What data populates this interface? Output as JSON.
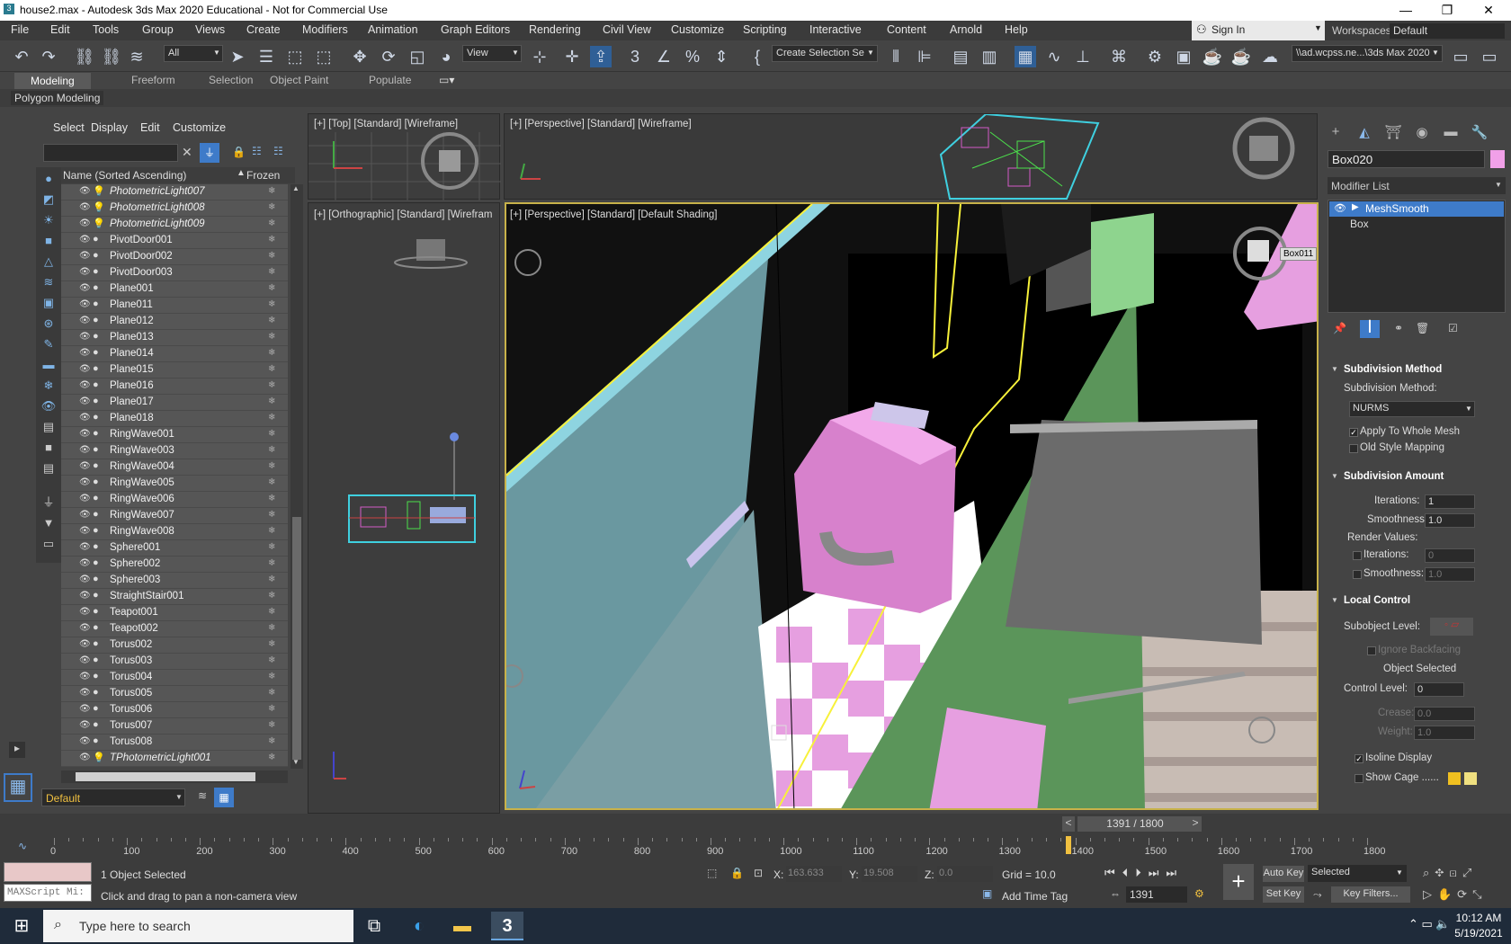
{
  "window": {
    "title": "house2.max - Autodesk 3ds Max 2020 Educational - Not for Commercial Use",
    "minimize": "—",
    "restore": "❐",
    "close": "✕"
  },
  "menu": [
    "File",
    "Edit",
    "Tools",
    "Group",
    "Views",
    "Create",
    "Modifiers",
    "Animation",
    "Graph Editors",
    "Rendering",
    "Civil View",
    "Customize",
    "Scripting",
    "Interactive",
    "Content",
    "Arnold",
    "Help"
  ],
  "signin": {
    "label": "Sign In"
  },
  "workspace": {
    "label": "Workspaces:",
    "value": "Default"
  },
  "toolbar": {
    "filter": "All",
    "refcoord": "View",
    "selection_set": "Create Selection Se",
    "path": "\\\\ad.wcpss.ne...\\3ds Max 2020"
  },
  "ribbon": {
    "tabs": [
      "Modeling",
      "Freeform",
      "Selection",
      "Object Paint",
      "Populate"
    ],
    "active": "Modeling",
    "panel": "Polygon Modeling"
  },
  "explorer": {
    "menu": [
      "Select",
      "Display",
      "Edit",
      "Customize"
    ],
    "col_name": "Name (Sorted Ascending)",
    "col_frozen": "Frozen",
    "rows": [
      {
        "name": "PhotometricLight007",
        "light": true
      },
      {
        "name": "PhotometricLight008",
        "light": true
      },
      {
        "name": "PhotometricLight009",
        "light": true
      },
      {
        "name": "PivotDoor001"
      },
      {
        "name": "PivotDoor002"
      },
      {
        "name": "PivotDoor003"
      },
      {
        "name": "Plane001"
      },
      {
        "name": "Plane011"
      },
      {
        "name": "Plane012"
      },
      {
        "name": "Plane013"
      },
      {
        "name": "Plane014"
      },
      {
        "name": "Plane015"
      },
      {
        "name": "Plane016"
      },
      {
        "name": "Plane017"
      },
      {
        "name": "Plane018"
      },
      {
        "name": "RingWave001"
      },
      {
        "name": "RingWave003"
      },
      {
        "name": "RingWave004"
      },
      {
        "name": "RingWave005"
      },
      {
        "name": "RingWave006"
      },
      {
        "name": "RingWave007"
      },
      {
        "name": "RingWave008"
      },
      {
        "name": "Sphere001"
      },
      {
        "name": "Sphere002"
      },
      {
        "name": "Sphere003"
      },
      {
        "name": "StraightStair001"
      },
      {
        "name": "Teapot001"
      },
      {
        "name": "Teapot002"
      },
      {
        "name": "Torus002"
      },
      {
        "name": "Torus003"
      },
      {
        "name": "Torus004"
      },
      {
        "name": "Torus005"
      },
      {
        "name": "Torus006"
      },
      {
        "name": "Torus007"
      },
      {
        "name": "Torus008"
      },
      {
        "name": "TPhotometricLight001",
        "light": true
      }
    ],
    "layer": "Default"
  },
  "viewports": {
    "top": "[+] [Top] [Standard] [Wireframe]",
    "persp_top": "[+] [Perspective] [Standard] [Wireframe]",
    "ortho": "[+] [Orthographic] [Standard] [Wirefram",
    "main": "[+] [Perspective] [Standard] [Default Shading]",
    "tooltip": "Box011"
  },
  "command_panel": {
    "object_name": "Box020",
    "modifier_list": "Modifier List",
    "stack": [
      "MeshSmooth",
      "Box"
    ],
    "subdiv_method": {
      "title": "Subdivision Method",
      "label": "Subdivision Method:",
      "value": "NURMS",
      "apply_whole": "Apply To Whole Mesh",
      "old_style": "Old Style Mapping"
    },
    "subdiv_amount": {
      "title": "Subdivision Amount",
      "iterations_label": "Iterations:",
      "iterations": "1",
      "smoothness_label": "Smoothness:",
      "smoothness": "1.0",
      "render_values": "Render Values:",
      "r_iterations": "0",
      "r_smoothness": "1.0"
    },
    "local_control": {
      "title": "Local Control",
      "subobject": "Subobject Level:",
      "ignore_backfacing": "Ignore Backfacing",
      "object_selected": "Object Selected",
      "control_level_label": "Control Level:",
      "control_level": "0",
      "crease_label": "Crease:",
      "crease": "0.0",
      "weight_label": "Weight:",
      "weight": "1.0",
      "isoline": "Isoline Display",
      "show_cage": "Show Cage ......"
    }
  },
  "timeline": {
    "frame": "1391 / 1800",
    "current": 1391,
    "total": 1800,
    "ticks": [
      "0",
      "100",
      "200",
      "300",
      "400",
      "500",
      "600",
      "700",
      "800",
      "900",
      "1000",
      "1100",
      "1200",
      "1300",
      "1400",
      "1500",
      "1600",
      "1700",
      "1800"
    ]
  },
  "status": {
    "maxscript": "MAXScript Mi:",
    "selected": "1 Object Selected",
    "prompt": "Click and drag to pan a non-camera view",
    "x_label": "X:",
    "x": "163.633",
    "y_label": "Y:",
    "y": "19.508",
    "z_label": "Z:",
    "z": "0.0",
    "grid": "Grid = 10.0",
    "add_time_tag": "Add Time Tag",
    "auto_key": "Auto Key",
    "set_key": "Set Key",
    "key_mode": "Selected",
    "key_filters": "Key Filters...",
    "frame_field": "1391"
  },
  "taskbar": {
    "search": "Type here to search",
    "time": "10:12 AM",
    "date": "5/19/2021"
  }
}
